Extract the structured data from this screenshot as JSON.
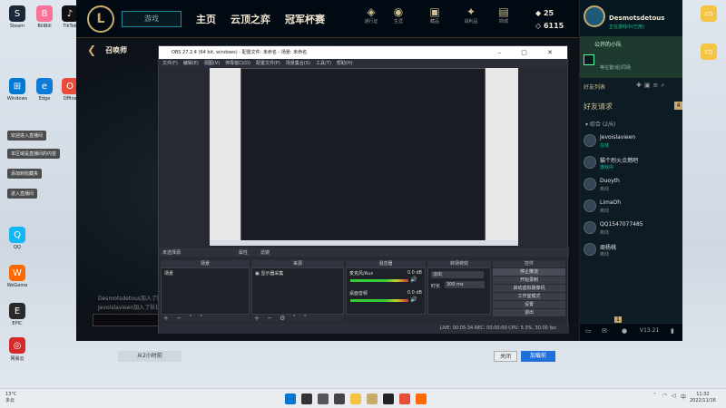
{
  "desktop": {
    "left_icons": [
      {
        "label": "Steam",
        "color": "#1b2838",
        "glyph": "S"
      },
      {
        "label": "BiliBili",
        "color": "#fb7299",
        "glyph": "B"
      },
      {
        "label": "TikTok",
        "color": "#111111",
        "glyph": "♪"
      },
      {
        "label": "Windows",
        "color": "#0078d4",
        "glyph": "⊞"
      },
      {
        "label": "Edge",
        "color": "#0f7bd6",
        "glyph": "e"
      },
      {
        "label": "Office",
        "color": "#e74c3c",
        "glyph": "O"
      },
      {
        "label": "QQ",
        "color": "#12b7f5",
        "glyph": "Q"
      },
      {
        "label": "WeGame",
        "color": "#ff6a00",
        "glyph": "W"
      },
      {
        "label": "EPIC",
        "color": "#2a2a2a",
        "glyph": "E"
      },
      {
        "label": "网易云",
        "color": "#d42a2a",
        "glyph": "◎"
      }
    ],
    "right_icons": [
      {
        "label": "",
        "color": "#f4c542",
        "glyph": "▭"
      },
      {
        "label": "",
        "color": "#f4c542",
        "glyph": "▭"
      }
    ],
    "notifications": [
      "欢迎进入直播间",
      "本区域是直播间的内容",
      "添加到收藏夹",
      "进入直播间"
    ]
  },
  "lol": {
    "play_label": "游戏",
    "nav": [
      "主页",
      "云顶之弈",
      "冠军杯赛"
    ],
    "top_icons": [
      {
        "label": "通行证",
        "icon": "◈"
      },
      {
        "label": "生涯",
        "icon": "◉"
      },
      {
        "label": "藏品",
        "icon": "▣"
      },
      {
        "label": "战利品",
        "icon": "✦"
      },
      {
        "label": "商城",
        "icon": "▤"
      }
    ],
    "currency": {
      "rp": "25",
      "be": "6115"
    },
    "sub_title": "召唤师",
    "chat_lines": [
      "Desmotsdetous加入了队伍",
      "Jevoislavieen加入了队伍"
    ],
    "social": {
      "name": "Desmotsdetous",
      "status": "正在游戏中(已用)",
      "club_title": "公开的小队",
      "club_sub": "等位置(组)同场",
      "friends_header": "好友列表",
      "requests_label": "好友请求",
      "requests_count": "4",
      "group_label": "▾ 综合 (2/6)",
      "friends": [
        {
          "name": "Jevoislavieen",
          "status": "在线",
          "status_color": "#0acf83"
        },
        {
          "name": "猫个烈火点燃吧",
          "status": "游戏中",
          "status_color": "#0ac8b9"
        },
        {
          "name": "Duoyth",
          "status": "离线",
          "status_color": "#888888"
        },
        {
          "name": "LimaOh",
          "status": "离线",
          "status_color": "#888888"
        },
        {
          "name": "QQ1547077485",
          "status": "离线",
          "status_color": "#888888"
        },
        {
          "name": "周杨桃",
          "status": "离线",
          "status_color": "#888888"
        }
      ],
      "footer_badge": "1",
      "footer_version": "V13.21"
    }
  },
  "obs": {
    "title": "OBS 27.2.4 (64 bit, windows) - 配置文件: 未命名 - 场景: 未命名",
    "menu": [
      "文件(F)",
      "编辑(E)",
      "视图(V)",
      "停靠窗口(D)",
      "配置文件(P)",
      "场景集合(S)",
      "工具(T)",
      "帮助(H)"
    ],
    "toolbar_label": "未选择源",
    "toolbar_props": "属性",
    "toolbar_filters": "滤镜",
    "docks": {
      "scenes_title": "场景",
      "scene_item": "场景",
      "sources_title": "来源",
      "source_item": "显示器采集",
      "mixer_title": "混音器",
      "mixer_ch1": "麦克风/Aux",
      "mixer_ch1_db": "0.0 dB",
      "mixer_ch2": "桌面音频",
      "mixer_ch2_db": "0.0 dB",
      "transitions_title": "转场特效",
      "transition_value": "淡出",
      "duration_label": "时长",
      "duration_value": "300 ms",
      "controls_title": "控件",
      "controls": [
        "停止推流",
        "开始录制",
        "启动虚拟摄像机",
        "工作室模式",
        "设置",
        "退出"
      ]
    },
    "status": "LIVE: 00:05:34   REC: 00:00:00   CPU: 5.3%, 30.00 fps"
  },
  "dialog": {
    "left_label": "从2小时前",
    "cancel_label": "关闭",
    "confirm_label": "加载前"
  },
  "taskbar": {
    "weather_temp": "13°C",
    "weather_desc": "多云",
    "time": "11:32",
    "date": "2022/11/16",
    "lang": "中",
    "apps": [
      "#0078d4",
      "#333333",
      "#555555",
      "#444444",
      "#f4c542",
      "#c8aa6e",
      "#222222",
      "#e74c3c",
      "#ff6a00"
    ]
  }
}
